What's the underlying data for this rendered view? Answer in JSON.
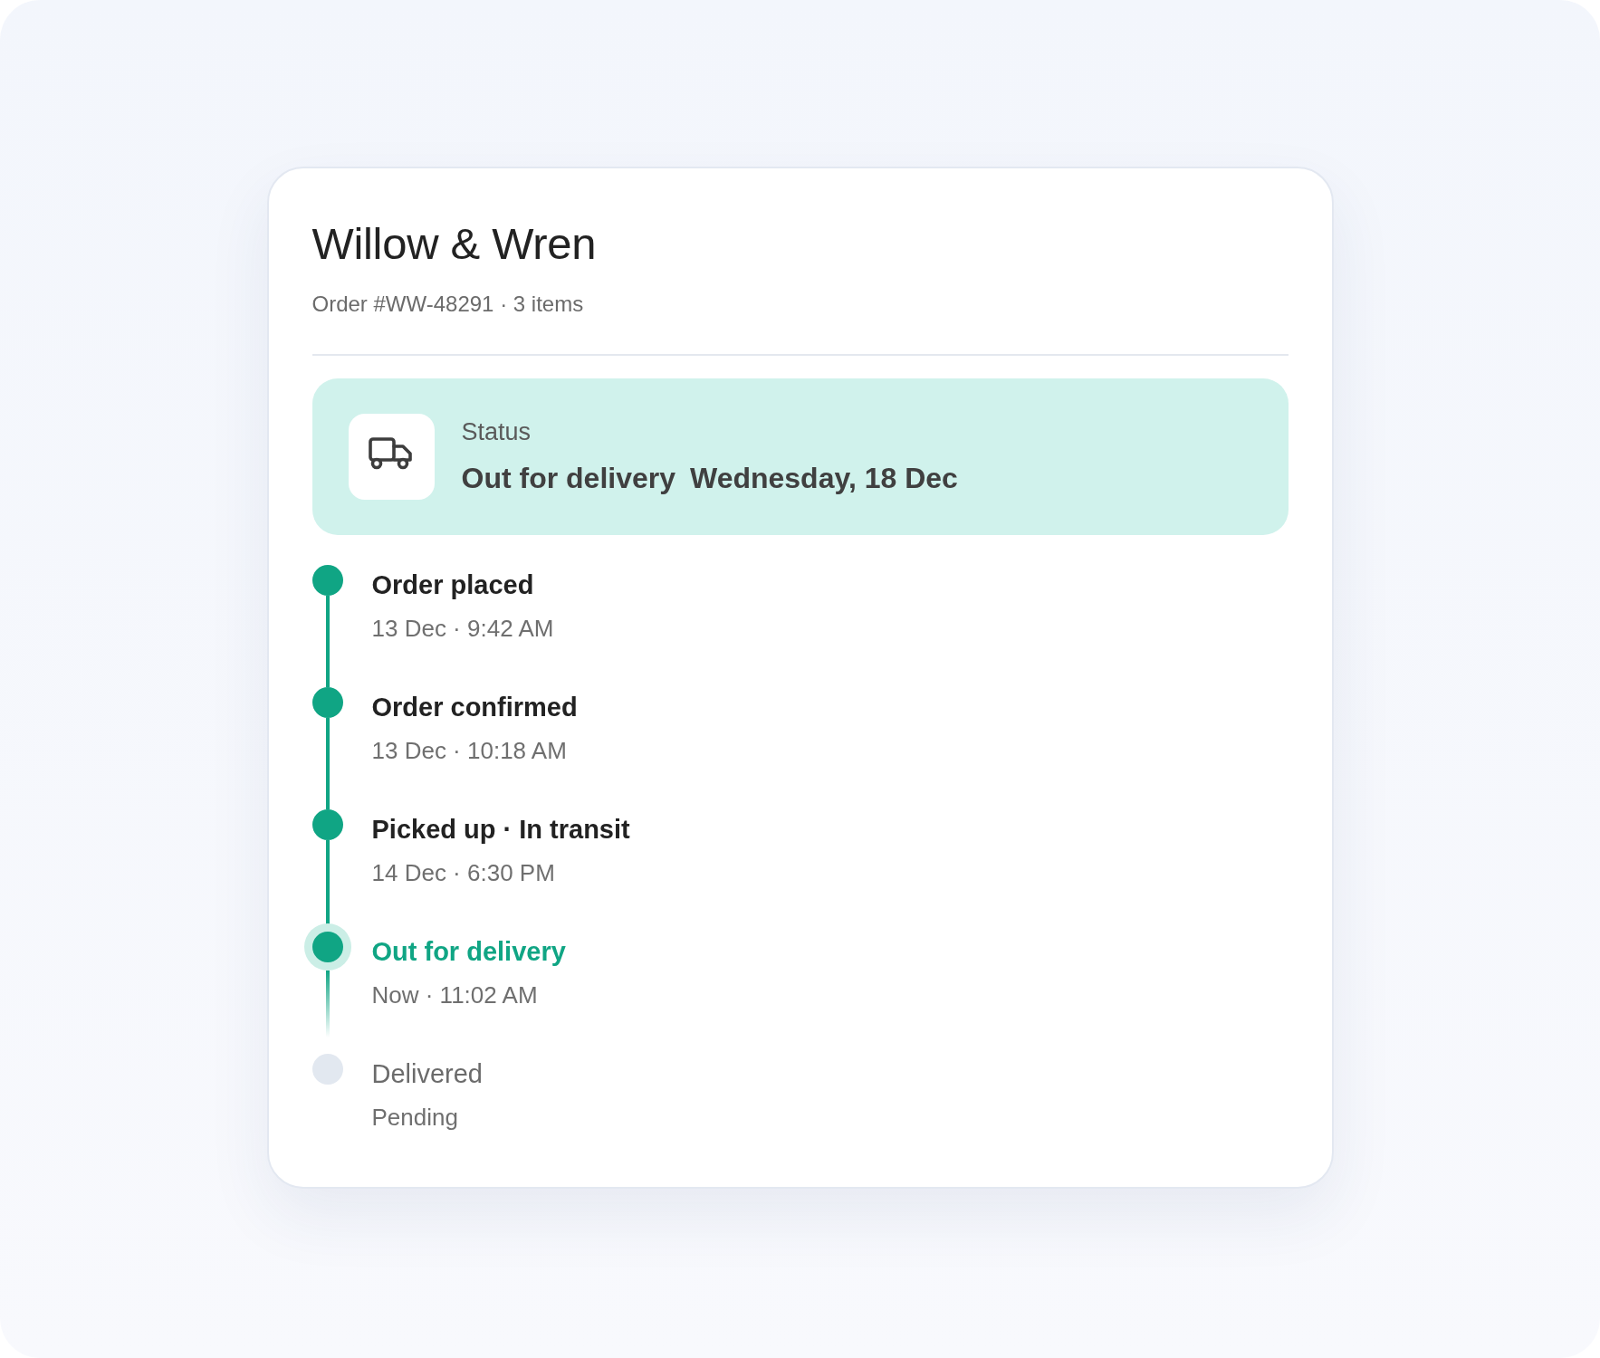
{
  "store": {
    "name": "Willow & Wren",
    "order_summary": "Order #WW-48291 · 3 items"
  },
  "status": {
    "label": "Status",
    "text": "Out for delivery",
    "eta": "Wednesday, 18 Dec"
  },
  "timeline": [
    {
      "title": "Order placed",
      "time": "13 Dec · 9:42 AM",
      "kind": "done"
    },
    {
      "title": "Order confirmed",
      "time": "13 Dec · 10:18 AM",
      "kind": "done"
    },
    {
      "title": "Picked up · In transit",
      "time": "14 Dec · 6:30 PM",
      "kind": "done"
    },
    {
      "title": "Out for delivery",
      "time": "Now · 11:02 AM",
      "kind": "current"
    },
    {
      "title": "Delivered",
      "time": "Pending",
      "kind": "pending"
    }
  ]
}
